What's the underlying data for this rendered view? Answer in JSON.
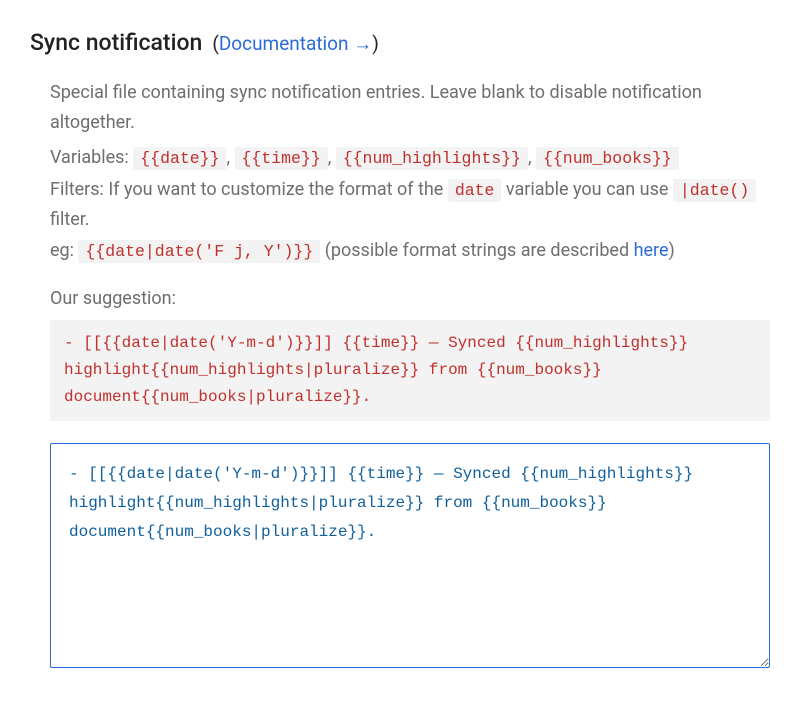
{
  "header": {
    "title": "Sync notification",
    "doc_link_label": "Documentation →",
    "paren_open": "(",
    "paren_close": ")"
  },
  "description": "Special file containing sync notification entries. Leave blank to disable notification altogether.",
  "variables": {
    "label": "Variables:",
    "list": [
      "{{date}}",
      "{{time}}",
      "{{num_highlights}}",
      "{{num_books}}"
    ],
    "sep": ", "
  },
  "filters": {
    "prefix": "Filters: If you want to customize the format of the ",
    "date_var": "date",
    "middle": " variable you can use ",
    "filter_name": "|date()",
    "suffix": " filter."
  },
  "example": {
    "prefix": "eg: ",
    "code": "{{date|date('F j, Y')}}",
    "after": " (possible format strings are described ",
    "here_label": "here",
    "close": ")"
  },
  "suggestion": {
    "label": "Our suggestion:",
    "code": "- [[{{date|date('Y-m-d')}}]] {{time}} — Synced {{num_highlights}} highlight{{num_highlights|pluralize}} from {{num_books}} document{{num_books|pluralize}}."
  },
  "editor": {
    "value": "- [[{{date|date('Y-m-d')}}]] {{time}} — Synced {{num_highlights}} highlight{{num_highlights|pluralize}} from {{num_books}} document{{num_books|pluralize}}."
  }
}
